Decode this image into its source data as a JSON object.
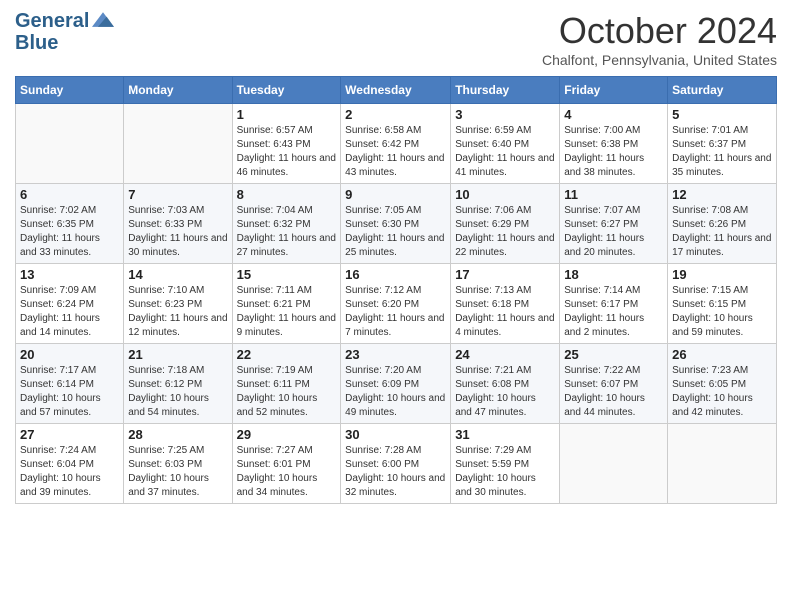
{
  "header": {
    "logo": {
      "line1": "General",
      "line2": "Blue"
    },
    "title": "October 2024",
    "subtitle": "Chalfont, Pennsylvania, United States"
  },
  "weekdays": [
    "Sunday",
    "Monday",
    "Tuesday",
    "Wednesday",
    "Thursday",
    "Friday",
    "Saturday"
  ],
  "weeks": [
    [
      {
        "day": null
      },
      {
        "day": null
      },
      {
        "day": 1,
        "sunrise": "Sunrise: 6:57 AM",
        "sunset": "Sunset: 6:43 PM",
        "daylight": "Daylight: 11 hours and 46 minutes."
      },
      {
        "day": 2,
        "sunrise": "Sunrise: 6:58 AM",
        "sunset": "Sunset: 6:42 PM",
        "daylight": "Daylight: 11 hours and 43 minutes."
      },
      {
        "day": 3,
        "sunrise": "Sunrise: 6:59 AM",
        "sunset": "Sunset: 6:40 PM",
        "daylight": "Daylight: 11 hours and 41 minutes."
      },
      {
        "day": 4,
        "sunrise": "Sunrise: 7:00 AM",
        "sunset": "Sunset: 6:38 PM",
        "daylight": "Daylight: 11 hours and 38 minutes."
      },
      {
        "day": 5,
        "sunrise": "Sunrise: 7:01 AM",
        "sunset": "Sunset: 6:37 PM",
        "daylight": "Daylight: 11 hours and 35 minutes."
      }
    ],
    [
      {
        "day": 6,
        "sunrise": "Sunrise: 7:02 AM",
        "sunset": "Sunset: 6:35 PM",
        "daylight": "Daylight: 11 hours and 33 minutes."
      },
      {
        "day": 7,
        "sunrise": "Sunrise: 7:03 AM",
        "sunset": "Sunset: 6:33 PM",
        "daylight": "Daylight: 11 hours and 30 minutes."
      },
      {
        "day": 8,
        "sunrise": "Sunrise: 7:04 AM",
        "sunset": "Sunset: 6:32 PM",
        "daylight": "Daylight: 11 hours and 27 minutes."
      },
      {
        "day": 9,
        "sunrise": "Sunrise: 7:05 AM",
        "sunset": "Sunset: 6:30 PM",
        "daylight": "Daylight: 11 hours and 25 minutes."
      },
      {
        "day": 10,
        "sunrise": "Sunrise: 7:06 AM",
        "sunset": "Sunset: 6:29 PM",
        "daylight": "Daylight: 11 hours and 22 minutes."
      },
      {
        "day": 11,
        "sunrise": "Sunrise: 7:07 AM",
        "sunset": "Sunset: 6:27 PM",
        "daylight": "Daylight: 11 hours and 20 minutes."
      },
      {
        "day": 12,
        "sunrise": "Sunrise: 7:08 AM",
        "sunset": "Sunset: 6:26 PM",
        "daylight": "Daylight: 11 hours and 17 minutes."
      }
    ],
    [
      {
        "day": 13,
        "sunrise": "Sunrise: 7:09 AM",
        "sunset": "Sunset: 6:24 PM",
        "daylight": "Daylight: 11 hours and 14 minutes."
      },
      {
        "day": 14,
        "sunrise": "Sunrise: 7:10 AM",
        "sunset": "Sunset: 6:23 PM",
        "daylight": "Daylight: 11 hours and 12 minutes."
      },
      {
        "day": 15,
        "sunrise": "Sunrise: 7:11 AM",
        "sunset": "Sunset: 6:21 PM",
        "daylight": "Daylight: 11 hours and 9 minutes."
      },
      {
        "day": 16,
        "sunrise": "Sunrise: 7:12 AM",
        "sunset": "Sunset: 6:20 PM",
        "daylight": "Daylight: 11 hours and 7 minutes."
      },
      {
        "day": 17,
        "sunrise": "Sunrise: 7:13 AM",
        "sunset": "Sunset: 6:18 PM",
        "daylight": "Daylight: 11 hours and 4 minutes."
      },
      {
        "day": 18,
        "sunrise": "Sunrise: 7:14 AM",
        "sunset": "Sunset: 6:17 PM",
        "daylight": "Daylight: 11 hours and 2 minutes."
      },
      {
        "day": 19,
        "sunrise": "Sunrise: 7:15 AM",
        "sunset": "Sunset: 6:15 PM",
        "daylight": "Daylight: 10 hours and 59 minutes."
      }
    ],
    [
      {
        "day": 20,
        "sunrise": "Sunrise: 7:17 AM",
        "sunset": "Sunset: 6:14 PM",
        "daylight": "Daylight: 10 hours and 57 minutes."
      },
      {
        "day": 21,
        "sunrise": "Sunrise: 7:18 AM",
        "sunset": "Sunset: 6:12 PM",
        "daylight": "Daylight: 10 hours and 54 minutes."
      },
      {
        "day": 22,
        "sunrise": "Sunrise: 7:19 AM",
        "sunset": "Sunset: 6:11 PM",
        "daylight": "Daylight: 10 hours and 52 minutes."
      },
      {
        "day": 23,
        "sunrise": "Sunrise: 7:20 AM",
        "sunset": "Sunset: 6:09 PM",
        "daylight": "Daylight: 10 hours and 49 minutes."
      },
      {
        "day": 24,
        "sunrise": "Sunrise: 7:21 AM",
        "sunset": "Sunset: 6:08 PM",
        "daylight": "Daylight: 10 hours and 47 minutes."
      },
      {
        "day": 25,
        "sunrise": "Sunrise: 7:22 AM",
        "sunset": "Sunset: 6:07 PM",
        "daylight": "Daylight: 10 hours and 44 minutes."
      },
      {
        "day": 26,
        "sunrise": "Sunrise: 7:23 AM",
        "sunset": "Sunset: 6:05 PM",
        "daylight": "Daylight: 10 hours and 42 minutes."
      }
    ],
    [
      {
        "day": 27,
        "sunrise": "Sunrise: 7:24 AM",
        "sunset": "Sunset: 6:04 PM",
        "daylight": "Daylight: 10 hours and 39 minutes."
      },
      {
        "day": 28,
        "sunrise": "Sunrise: 7:25 AM",
        "sunset": "Sunset: 6:03 PM",
        "daylight": "Daylight: 10 hours and 37 minutes."
      },
      {
        "day": 29,
        "sunrise": "Sunrise: 7:27 AM",
        "sunset": "Sunset: 6:01 PM",
        "daylight": "Daylight: 10 hours and 34 minutes."
      },
      {
        "day": 30,
        "sunrise": "Sunrise: 7:28 AM",
        "sunset": "Sunset: 6:00 PM",
        "daylight": "Daylight: 10 hours and 32 minutes."
      },
      {
        "day": 31,
        "sunrise": "Sunrise: 7:29 AM",
        "sunset": "Sunset: 5:59 PM",
        "daylight": "Daylight: 10 hours and 30 minutes."
      },
      {
        "day": null
      },
      {
        "day": null
      }
    ]
  ]
}
